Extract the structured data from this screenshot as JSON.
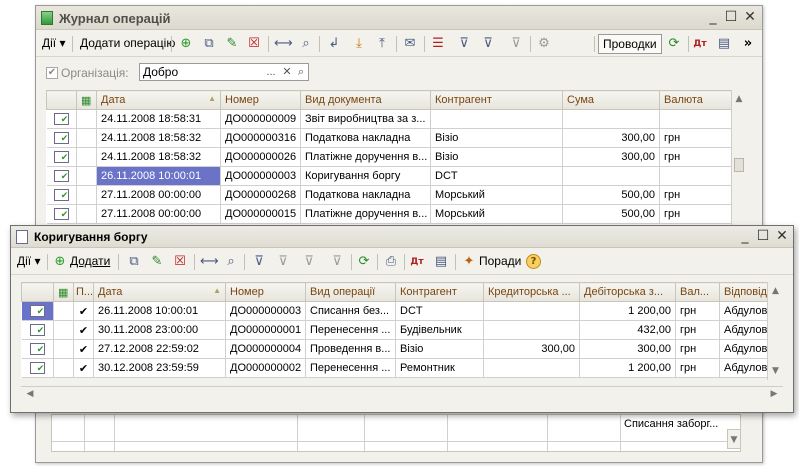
{
  "journal": {
    "title": "Журнал операцій",
    "toolbar": {
      "actions": "Дії",
      "add_operation": "Додати операцію",
      "postings": "Проводки"
    },
    "filter": {
      "org_label": "Організація:",
      "org_value": "Добро",
      "org_checked": true
    },
    "columns": [
      "Дата",
      "Номер",
      "Вид документа",
      "Контрагент",
      "Сума",
      "Валюта"
    ],
    "rows": [
      {
        "date": "24.11.2008 18:58:31",
        "number": "ДО000000009",
        "doc_type": "Звіт виробництва за з...",
        "counterparty": "",
        "sum": "",
        "currency": ""
      },
      {
        "date": "24.11.2008 18:58:32",
        "number": "ДО000000316",
        "doc_type": "Податкова накладна",
        "counterparty": "Візіо",
        "sum": "300,00",
        "currency": "грн"
      },
      {
        "date": "24.11.2008 18:58:32",
        "number": "ДО000000026",
        "doc_type": "Платіжне доручення в...",
        "counterparty": "Візіо",
        "sum": "300,00",
        "currency": "грн"
      },
      {
        "date": "26.11.2008 10:00:01",
        "number": "ДО000000003",
        "doc_type": "Коригування боргу",
        "counterparty": "DCT",
        "sum": "",
        "currency": "",
        "selected": true
      },
      {
        "date": "27.11.2008 00:00:00",
        "number": "ДО000000268",
        "doc_type": "Податкова накладна",
        "counterparty": "Морський",
        "sum": "500,00",
        "currency": "грн"
      },
      {
        "date": "27.11.2008 00:00:00",
        "number": "ДО000000015",
        "doc_type": "Платіжне доручення в...",
        "counterparty": "Морський",
        "sum": "500,00",
        "currency": "грн"
      }
    ],
    "lower_text": "Списання заборг..."
  },
  "adjustment": {
    "title": "Коригування боргу",
    "toolbar": {
      "actions": "Дії",
      "add": "Додати",
      "tips": "Поради"
    },
    "columns": [
      "П...",
      "Дата",
      "Номер",
      "Вид операції",
      "Контрагент",
      "Кредиторська ...",
      "Дебіторська з...",
      "Вал...",
      "Відповіда"
    ],
    "rows": [
      {
        "posted": true,
        "date": "26.11.2008 10:00:01",
        "number": "ДО000000003",
        "op_type": "Списання без...",
        "counterparty": "DCT",
        "credit": "",
        "debit": "1 200,00",
        "currency": "грн",
        "responsible": "Абдулов",
        "selected": true
      },
      {
        "posted": true,
        "date": "30.11.2008 23:00:00",
        "number": "ДО000000001",
        "op_type": "Перенесення ...",
        "counterparty": "Будівельник",
        "credit": "",
        "debit": "432,00",
        "currency": "грн",
        "responsible": "Абдулов"
      },
      {
        "posted": true,
        "date": "27.12.2008 22:59:02",
        "number": "ДО000000004",
        "op_type": "Проведення в...",
        "counterparty": "Візіо",
        "credit": "300,00",
        "debit": "300,00",
        "currency": "грн",
        "responsible": "Абдулов"
      },
      {
        "posted": true,
        "date": "30.12.2008 23:59:59",
        "number": "ДО000000002",
        "op_type": "Перенесення ...",
        "counterparty": "Ремонтник",
        "credit": "",
        "debit": "1 200,00",
        "currency": "грн",
        "responsible": "Абдулов"
      }
    ]
  },
  "glyphs": {
    "minimize": "_",
    "maximize": "☐",
    "close": "✕",
    "more": "»",
    "dropdown": "▾",
    "scroll_up": "▲",
    "scroll_down": "▼",
    "scroll_left": "◀",
    "scroll_right": "▶",
    "sort": "▲",
    "check": "✔",
    "ellipsis": "...",
    "clear": "✕",
    "help": "?"
  },
  "colors": {
    "selection": "#6a73c8",
    "header_text": "#7a4510",
    "window_bg": "#f2f1ec"
  }
}
